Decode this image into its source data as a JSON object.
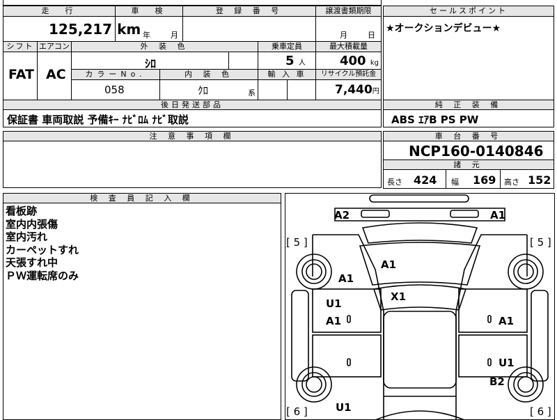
{
  "header": {
    "mileage_label": "走　行",
    "inspection_label": "車　検",
    "registration_label": "登 録 番 号",
    "transfer_label": "譲渡書類期限",
    "selling_point_label": "セールスポイント",
    "mileage_value": "125,217",
    "mileage_unit": "km",
    "year_unit": "年",
    "month_unit": "月",
    "day_unit": "日",
    "selling_point_text": "★オークションデビュー★"
  },
  "spec": {
    "shift_label": "シフト",
    "ac_label": "エアコン",
    "exterior_label": "外 装 色",
    "capacity_label": "乗車定員",
    "max_load_label": "最大積載量",
    "shift_value": "FAT",
    "ac_value": "AC",
    "exterior_value": "ｼﾛ",
    "capacity_value": "5",
    "capacity_unit": "人",
    "max_load_value": "400",
    "max_load_unit": "kg",
    "color_no_label": "カラーNo.",
    "interior_label": "内 装 色",
    "import_label": "輸 入 車",
    "recycle_label": "リサイクル預託金",
    "color_no_value": "058",
    "interior_value": "ｸﾛ",
    "interior_unit": "系",
    "recycle_value": "7,440",
    "recycle_unit": "円"
  },
  "later_parts": {
    "label": "後日発送部品",
    "value": "保証書 車両取説 予備ｷｰ ﾅﾋﾞﾛﾑ ﾅﾋﾞ取説"
  },
  "genuine_equipment": {
    "label": "純 正 装 備",
    "value": "ABS ｴｱB PS PW"
  },
  "notes": {
    "label": "注 意 事 項 欄"
  },
  "chassis": {
    "label": "車 台 番 号",
    "value": "NCP160-0140846"
  },
  "dimensions": {
    "label": "諸 元",
    "length_label": "長さ",
    "length_value": "424",
    "width_label": "幅",
    "width_value": "169",
    "height_label": "高さ",
    "height_value": "152"
  },
  "inspector": {
    "label": "検 査 員 記 入 欄",
    "lines": [
      "看板跡",
      "室内内張傷",
      "室内汚れ",
      "カーペットすれ",
      "天張すれ中",
      "ＰＷ運転席のみ"
    ]
  },
  "diagram": {
    "tire_front_left": "[ 5 ]",
    "tire_front_right": "[ 5 ]",
    "tire_rear_left": "[ 6 ]",
    "tire_rear_right": "[ 6 ]",
    "marks": {
      "front_left_corner": "A2",
      "front_right_corner": "A1",
      "hood": "A1",
      "left_fender": "A1",
      "windshield": "X1",
      "left_front_door_upper": "U1",
      "left_front_door": "A1",
      "right_front_door": "A1",
      "right_rear_door": "U1",
      "right_rear_fender": "B2",
      "left_rear": "U1"
    }
  }
}
